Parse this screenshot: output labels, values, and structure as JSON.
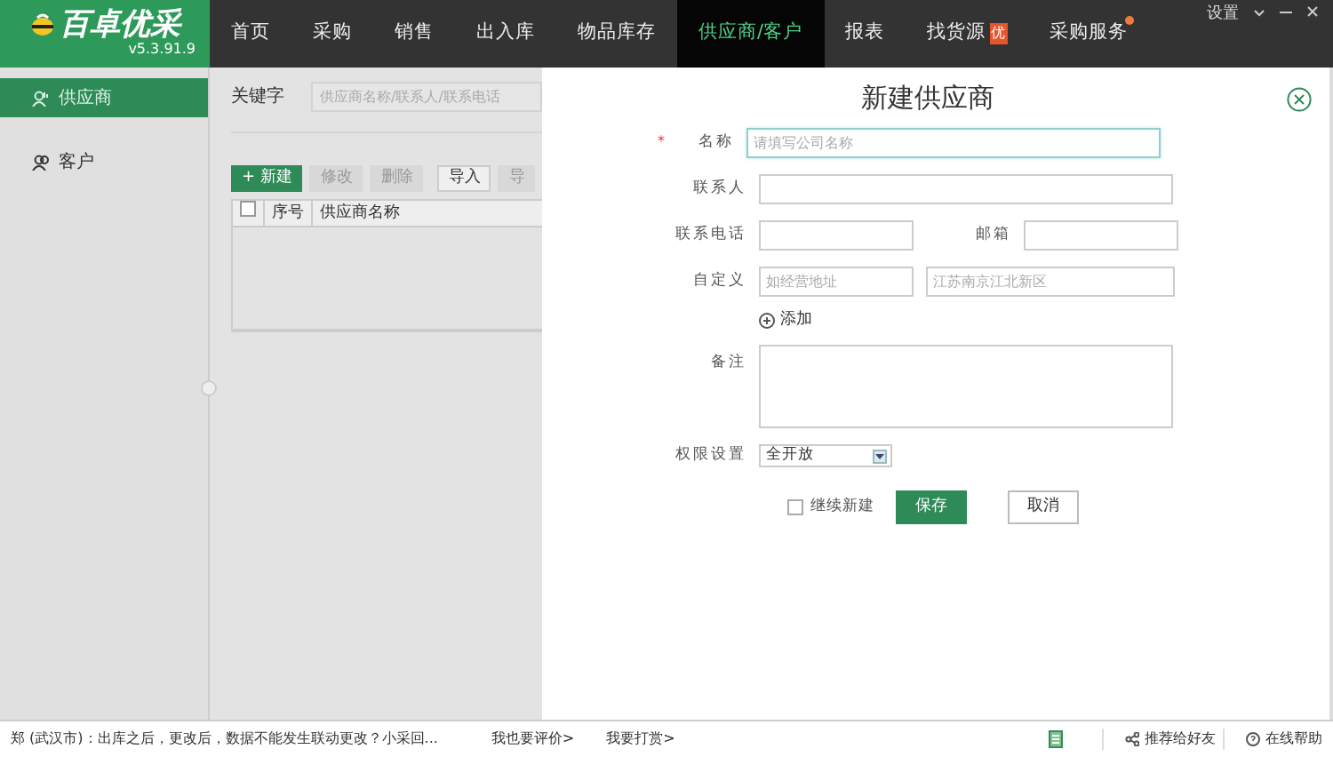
{
  "app": {
    "name": "百卓优采",
    "version": "v5.3.91.9"
  },
  "nav": [
    {
      "label": "首页",
      "selected": false
    },
    {
      "label": "采购",
      "selected": false
    },
    {
      "label": "销售",
      "selected": false
    },
    {
      "label": "出入库",
      "selected": false
    },
    {
      "label": "物品库存",
      "selected": false
    },
    {
      "label": "供应商/客户",
      "selected": true
    },
    {
      "label": "报表",
      "selected": false
    },
    {
      "label": "找货源",
      "selected": false,
      "badge": "优"
    },
    {
      "label": "采购服务",
      "selected": false,
      "dot": true
    }
  ],
  "window_controls": {
    "settings": "设置"
  },
  "sidebar": {
    "items": [
      {
        "label": "供应商",
        "selected": true
      },
      {
        "label": "客户",
        "selected": false
      }
    ]
  },
  "list_panel": {
    "keyword_label": "关键字",
    "search_placeholder": "供应商名称/联系人/联系电话",
    "toolbar": [
      {
        "label": "+ 新建",
        "kind": "primary"
      },
      {
        "label": "修改",
        "kind": "disabled"
      },
      {
        "label": "删除",
        "kind": "disabled"
      },
      {
        "label": "导入",
        "kind": "default"
      },
      {
        "label": "导",
        "kind": "disabled"
      }
    ],
    "select_all": {
      "checked": false
    },
    "columns": [
      "序号",
      "供应商名称"
    ]
  },
  "dialog": {
    "title": "新建供应商",
    "name": {
      "label": "名称",
      "required": true,
      "required_mark": "*",
      "placeholder": "请填写公司名称"
    },
    "contact": {
      "label": "联系人"
    },
    "phone": {
      "label": "联系电话"
    },
    "email": {
      "label": "邮箱"
    },
    "custom": {
      "label": "自定义",
      "placeholders": [
        "如经营地址",
        "江苏南京江北新区"
      ]
    },
    "add_label": "添加",
    "remarks": {
      "label": "备注"
    },
    "permission": {
      "label": "权限设置",
      "value": "全开放"
    },
    "continue": {
      "label": "继续新建",
      "checked": false
    },
    "buttons": [
      {
        "label": "保存",
        "kind": "primary"
      },
      {
        "label": "取消",
        "kind": "default"
      }
    ]
  },
  "status_bar": {
    "message": "郑 (武汉市)：出库之后，更改后，数据不能发生联动更改？小采回...",
    "links": [
      "我也要评价>",
      "我要打赏>"
    ],
    "share": "推荐给好友",
    "help": "在线帮助"
  }
}
